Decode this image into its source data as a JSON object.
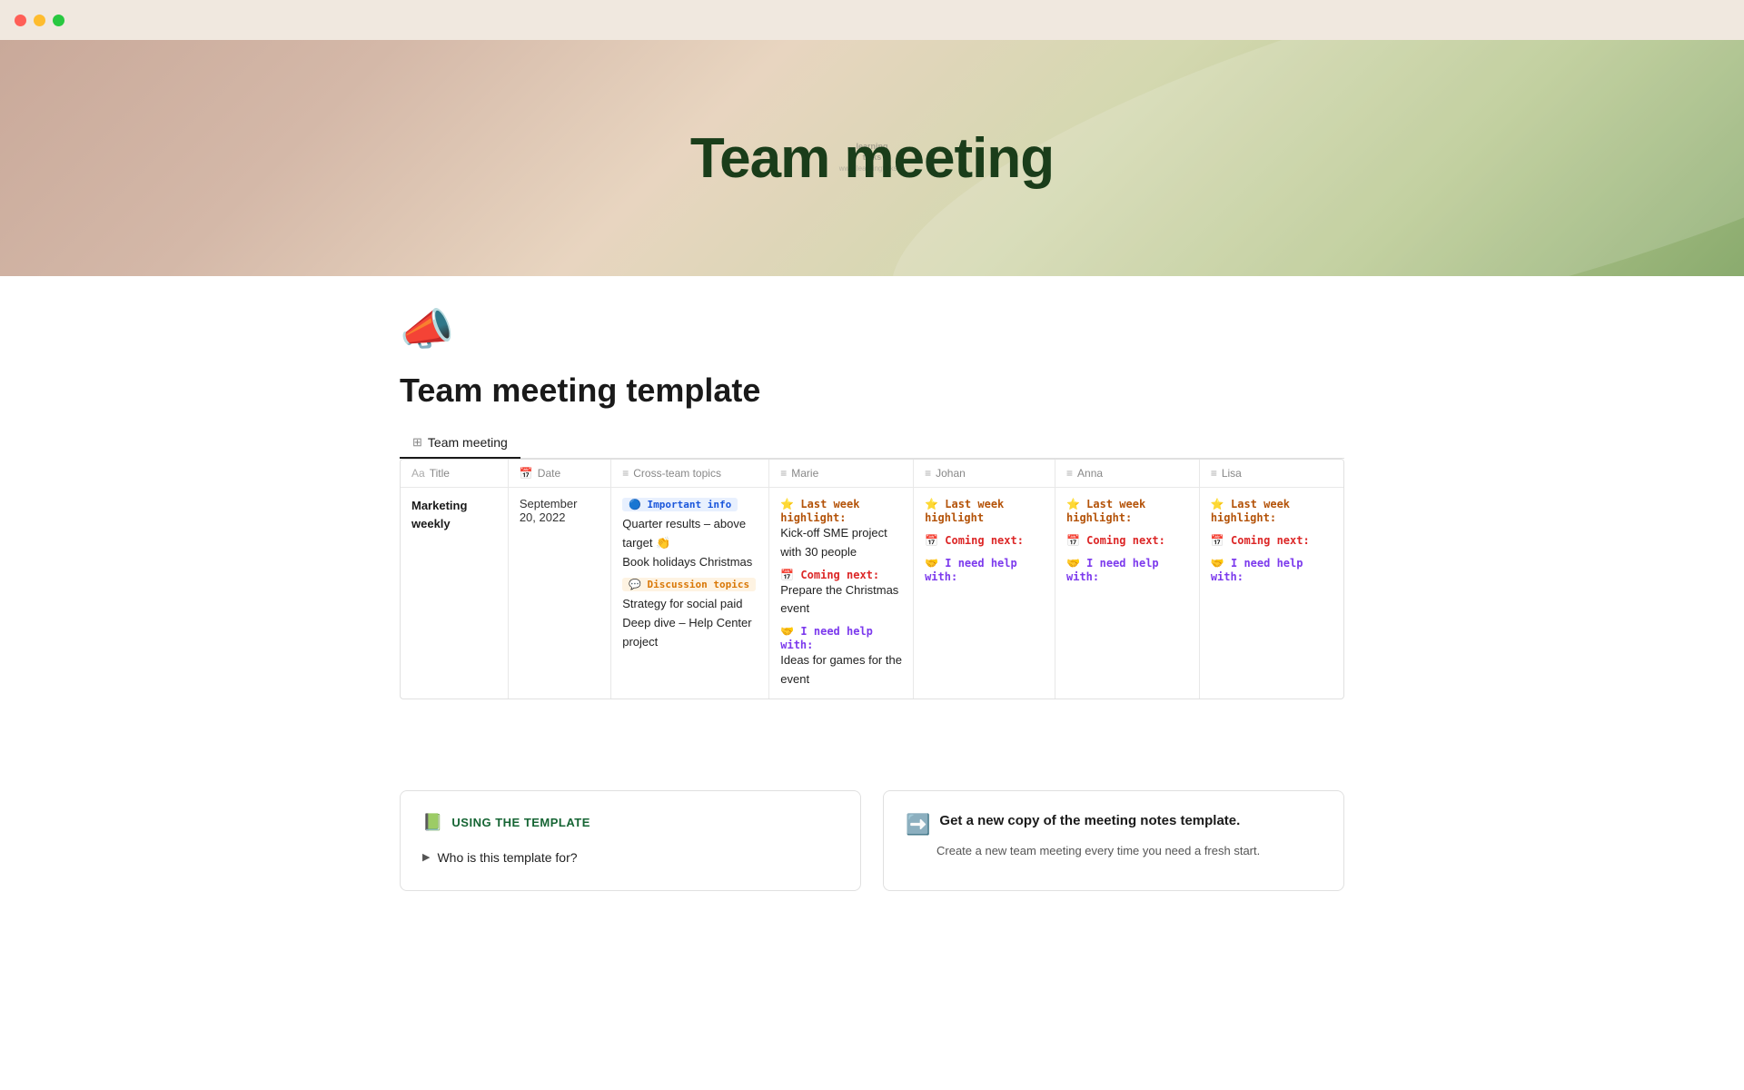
{
  "titlebar": {
    "buttons": [
      "close",
      "minimize",
      "maximize"
    ]
  },
  "hero": {
    "title": "Team meeting"
  },
  "page": {
    "icon": "📣",
    "title": "Team meeting template",
    "tab_label": "Team meeting"
  },
  "table": {
    "columns": [
      {
        "icon": "Aa",
        "label": "Title"
      },
      {
        "icon": "📅",
        "label": "Date"
      },
      {
        "icon": "≡",
        "label": "Cross-team topics"
      },
      {
        "icon": "≡",
        "label": "Marie"
      },
      {
        "icon": "≡",
        "label": "Johan"
      },
      {
        "icon": "≡",
        "label": "Anna"
      },
      {
        "icon": "≡",
        "label": "Lisa"
      }
    ],
    "rows": [
      {
        "title": "Marketing weekly",
        "date": "September 20, 2022",
        "cross_team": {
          "important_tag": "🔵 Important info",
          "important_items": [
            "Quarter results – above target 👏",
            "Book holidays Christmas"
          ],
          "discussion_tag": "💬 Discussion topics",
          "discussion_items": [
            "Strategy for social paid",
            "Deep dive – Help Center project"
          ]
        },
        "marie": {
          "highlight_tag": "⭐ Last week highlight:",
          "highlight_text": "Kick-off SME project with 30 people",
          "coming_tag": "📅 Coming next:",
          "coming_text": "Prepare the Christmas event",
          "help_tag": "🤝 I need help with:",
          "help_text": "Ideas for games for the event"
        },
        "johan": {
          "highlight_tag": "⭐ Last week highlight",
          "coming_tag": "📅 Coming next:",
          "help_tag": "🤝 I need help with:"
        },
        "anna": {
          "highlight_tag": "⭐ Last week highlight:",
          "coming_tag": "📅 Coming next:",
          "help_tag": "🤝 I need help with:"
        },
        "lisa": {
          "highlight_tag": "⭐ Last week highlight:",
          "coming_tag": "📅 Coming next:",
          "help_tag": "🤝 I need help with:"
        }
      }
    ]
  },
  "bottom": {
    "left_card": {
      "icon": "📗",
      "label": "USING THE TEMPLATE",
      "items": [
        {
          "label": "Who is this template for?"
        }
      ]
    },
    "right_card": {
      "icon": "➡️",
      "title": "Get a new copy of the meeting notes template.",
      "description": "Create a new team meeting every time you need a fresh start."
    }
  }
}
